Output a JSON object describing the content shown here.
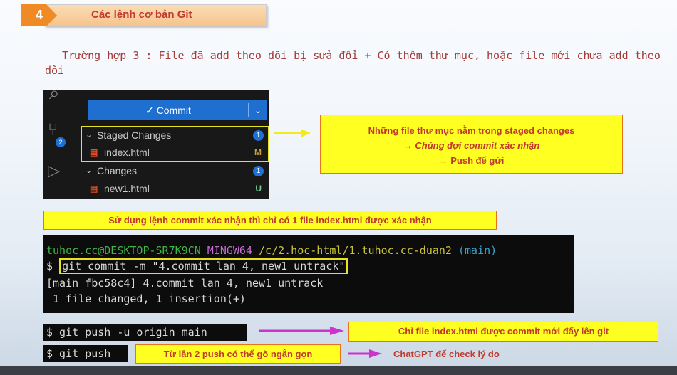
{
  "header": {
    "number": "4",
    "title": "Các lệnh cơ bản Git"
  },
  "intro": "Trường hợp 3 : File đã add theo dõi bị sửa đổi + Có thêm thư mục, hoặc file mới chưa add theo dõi",
  "vscode": {
    "commit_label": "✓ Commit",
    "scm_badge": "2",
    "staged": {
      "label": "Staged Changes",
      "count": "1"
    },
    "staged_file": {
      "name": "index.html",
      "status": "M"
    },
    "changes": {
      "label": "Changes",
      "count": "1"
    },
    "changes_file": {
      "name": "new1.html",
      "status": "U"
    }
  },
  "callout_staged": {
    "line1": "Những file thư mục nằm trong staged changes",
    "line2": "→ Chúng đợi commit xác nhận",
    "line3": "→ Push để gửi"
  },
  "banner": "Sử dụng lệnh commit xác nhận thì chỉ có 1 file index.html được xác nhận",
  "terminal": {
    "user_host": "tuhoc.cc@DESKTOP-SR7K9CN",
    "shell": "MINGW64",
    "path": "/c/2.hoc-html/1.tuhoc.cc-duan2",
    "branch": "(main)",
    "prompt": "$",
    "command": "git commit -m \"4.commit lan 4, new1 untrack\"",
    "out1": "[main fbc58c4] 4.commit lan 4, new1 untrack",
    "out2": " 1 file changed, 1 insertion(+)"
  },
  "push1": {
    "cmd": "$ git push -u origin main",
    "note": "Chỉ file index.html được commit mới đẩy lên git"
  },
  "push2": {
    "cmd": "$ git push",
    "note": "Từ lần 2 push có thể gõ ngắn gọn",
    "note2": "ChatGPT để check lý do"
  },
  "colors": {
    "arrow": "#cc33cc",
    "callout_bg": "#ffff22",
    "accent": "#f08a24"
  }
}
